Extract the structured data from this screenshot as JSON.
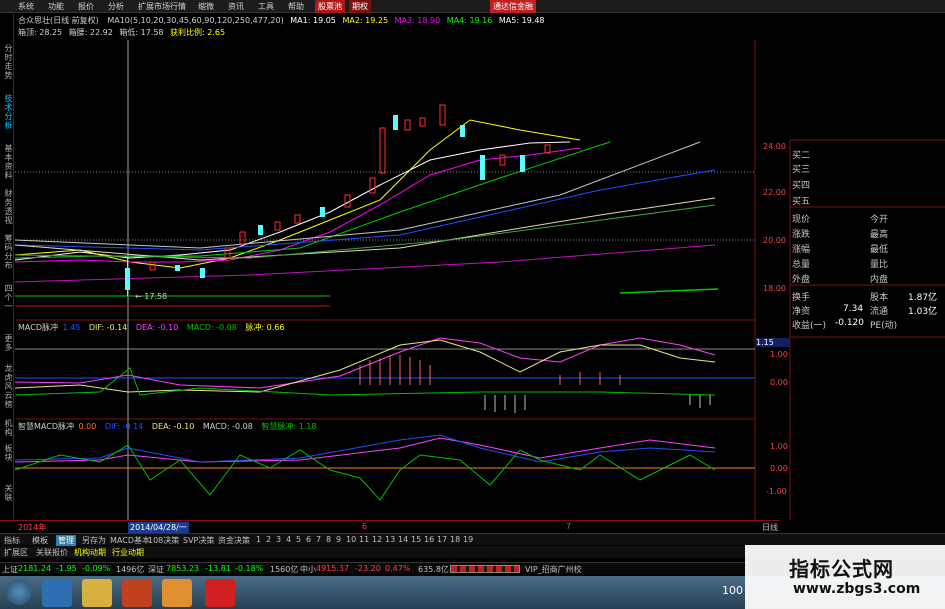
{
  "menu": {
    "items": [
      "系统",
      "功能",
      "报价",
      "分析",
      "扩展市场行情",
      "缩微",
      "资讯",
      "工具",
      "帮助"
    ],
    "tab_active": "股票池",
    "tab_other": "期权",
    "right_button": "通达信金融"
  },
  "left_tabs": [
    "分时走势",
    "技术分析",
    "基本资料",
    "财务透视",
    "筹码分布",
    "四个一",
    "更多",
    "龙虎风云榜",
    "机构",
    "板块",
    "关联"
  ],
  "chart_header": {
    "stock": "合众思壮(日线 前复权)",
    "ma_params": "MA10(5,10,20,30,45,60,90,120,250,477,20)",
    "ma1": "MA1: 19.05",
    "ma2": "MA2: 19.25",
    "ma3": "MA3: 18.90",
    "ma4": "MA4: 19.16",
    "ma5": "MA5: 19.48",
    "row2_a": "箱顶: 28.25",
    "row2_b": "箱腰: 22.92",
    "row2_c": "箱低: 17.58",
    "row2_d": "获利比例: 2.65"
  },
  "price_axis": {
    "labels": [
      "24.00",
      "22.00",
      "20.00",
      "18.00"
    ],
    "low_marker": "← 17.58"
  },
  "right_panel": {
    "depth": [
      "买二",
      "买三",
      "买四",
      "买五"
    ],
    "rows": [
      {
        "l": "现价",
        "m": "",
        "r": "今开"
      },
      {
        "l": "涨跌",
        "m": "",
        "r": "最高"
      },
      {
        "l": "涨幅",
        "m": "",
        "r": "最低"
      },
      {
        "l": "总量",
        "m": "",
        "r": "量比"
      },
      {
        "l": "外盘",
        "m": "",
        "r": "内盘"
      },
      {
        "l": "换手",
        "m": "",
        "r": "股本",
        "v": "1.87亿"
      },
      {
        "l": "净资",
        "m": "7.34",
        "r": "流通",
        "v": "1.03亿"
      },
      {
        "l": "收益(一)",
        "m": "-0.120",
        "r": "PE(动)",
        "v": ""
      }
    ]
  },
  "macd_header": {
    "name": "MACD脉冲",
    "param": "1.45",
    "dif": "DIF: -0.14",
    "dea": "DEA: -0.10",
    "macd": "MACD: -0.08",
    "pulse": "脉冲: 0.66"
  },
  "macd_axis": [
    "1.15",
    "1.00",
    "0.00"
  ],
  "macd2_header": {
    "name": "智慧MACD脉冲",
    "param": "0.00",
    "dif": "DIF: -0.14",
    "dea": "DEA: -0.10",
    "macd": "MACD: -0.08",
    "pulse": "智慧脉冲: 1.18"
  },
  "macd2_axis": [
    "1.00",
    "0.00",
    "-1.00"
  ],
  "time_axis": {
    "year": "2014年",
    "cursor_date": "2014/04/28/一",
    "m6": "6",
    "m7": "7",
    "period": "日线"
  },
  "toolbar1": {
    "items": [
      "指标",
      "模板",
      "管理",
      "另存为",
      "MACD基本",
      "108决策",
      "SVP决策",
      "资金决策"
    ],
    "selected": "管理",
    "pages": [
      "1",
      "2",
      "3",
      "4",
      "5",
      "6",
      "7",
      "8",
      "9",
      "10",
      "11",
      "12",
      "13",
      "14",
      "15",
      "16",
      "17",
      "18",
      "19"
    ]
  },
  "toolbar2": {
    "items": [
      "扩展区",
      "关联报价",
      "机构动期",
      "行业动期"
    ]
  },
  "status": {
    "sh_label": "上证",
    "sh_value": "2181.24",
    "sh_chg": "-1.95",
    "sh_pct": "-0.09%",
    "sh_amt": "1496亿",
    "sz_label": "深证",
    "sz_value": "7853.23",
    "sz_chg": "-13.81",
    "sz_pct": "-0.18%",
    "sz_amt": "1560亿",
    "zx_label": "中小",
    "zx_value": "4915.37",
    "zx_chg": "-23.20",
    "zx_pct": "0.47%",
    "zx_amt": "635.8亿",
    "vip": "VIP_招商广州校"
  },
  "watermark": {
    "title": "指标公式网",
    "url": "www.zbgs3.com"
  },
  "taskbar": {
    "clock": "100"
  },
  "colors": {
    "ma1": "#ffffff",
    "ma2": "#ffff00",
    "ma3": "#ff00ff",
    "ma4": "#00ff00",
    "ma5": "#0080ff",
    "up": "#ff3030",
    "down": "#54ffff",
    "axis": "#a01010"
  }
}
